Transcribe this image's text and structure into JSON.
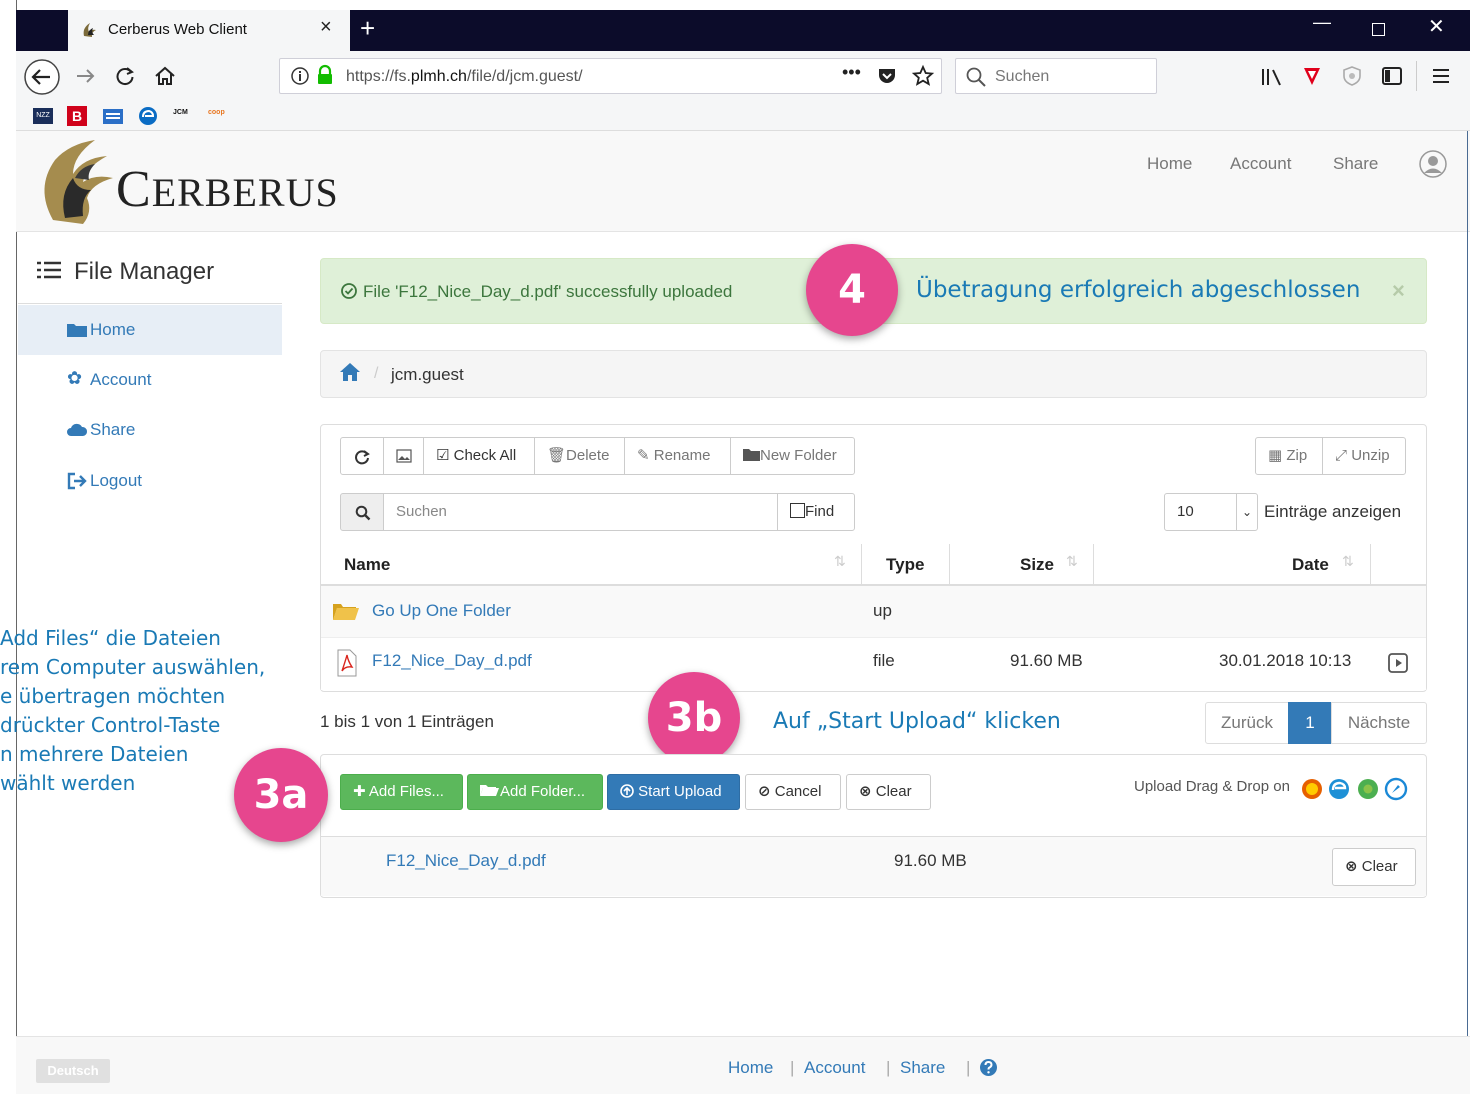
{
  "browser": {
    "tab_title": "Cerberus Web Client",
    "tab_close": "×",
    "new_tab": "+",
    "url_prefix": "https://fs.",
    "url_domain": "plmh.ch",
    "url_path": "/file/d/jcm.guest/",
    "search_placeholder": "Suchen",
    "bookmark_b": "B",
    "bookmark_nzz": "NZZ"
  },
  "site": {
    "logo": "Cerberus",
    "nav": [
      "Home",
      "Account",
      "Share"
    ]
  },
  "sidebar": {
    "title": "File Manager",
    "items": [
      {
        "label": "Home",
        "icon": "folder-icon",
        "active": true
      },
      {
        "label": "Account",
        "icon": "gear-icon"
      },
      {
        "label": "Share",
        "icon": "cloud-icon"
      },
      {
        "label": "Logout",
        "icon": "logout-icon"
      }
    ]
  },
  "alert": {
    "message": "File 'F12_Nice_Day_d.pdf' successfully uploaded",
    "close": "×"
  },
  "annotations": {
    "badge_4": "4",
    "text_4": "Übetragung erfolgreich abgeschlossen",
    "badge_3b": "3b",
    "text_3b": "Auf „Start Upload“ klicken",
    "badge_3a": "3a",
    "text_3a_lines": [
      "Add Files“ die Dateien",
      "rem Computer auswählen,",
      "e übertragen möchten",
      "drückter Control-Taste",
      "n mehrere Dateien",
      "wählt werden"
    ]
  },
  "breadcrumb": {
    "path": "jcm.guest"
  },
  "toolbar": {
    "check_all": "Check All",
    "delete": "Delete",
    "rename": "Rename",
    "new_folder": "New Folder",
    "zip": "Zip",
    "unzip": "Unzip",
    "search_placeholder": "Suchen",
    "find": "Find",
    "page_size": "10",
    "entries_label": "Einträge anzeigen"
  },
  "table": {
    "headers": {
      "name": "Name",
      "type": "Type",
      "size": "Size",
      "date": "Date"
    },
    "rows": [
      {
        "name": "Go Up One Folder",
        "type": "up",
        "size": "",
        "date": ""
      },
      {
        "name": "F12_Nice_Day_d.pdf",
        "type": "file",
        "size": "91.60 MB",
        "date": "30.01.2018 10:13"
      }
    ],
    "info": "1 bis 1 von 1 Einträgen"
  },
  "pagination": {
    "prev": "Zurück",
    "current": "1",
    "next": "Nächste"
  },
  "upload": {
    "add_files": "Add Files...",
    "add_folder": "Add Folder...",
    "start_upload": "Start Upload",
    "cancel": "Cancel",
    "clear": "Clear",
    "drag_drop": "Upload Drag & Drop on",
    "file_name": "F12_Nice_Day_d.pdf",
    "file_size": "91.60 MB",
    "file_clear": "Clear"
  },
  "footer": {
    "language": "Deutsch",
    "links": [
      "Home",
      "Account",
      "Share"
    ],
    "separator": "|"
  },
  "colors": {
    "link": "#337ab7",
    "success_bg": "#dff0d8",
    "success_text": "#3c763d",
    "badge": "#e6468e",
    "annotation": "#1a7ab5",
    "primary": "#337ab7",
    "green": "#5cb85c"
  }
}
